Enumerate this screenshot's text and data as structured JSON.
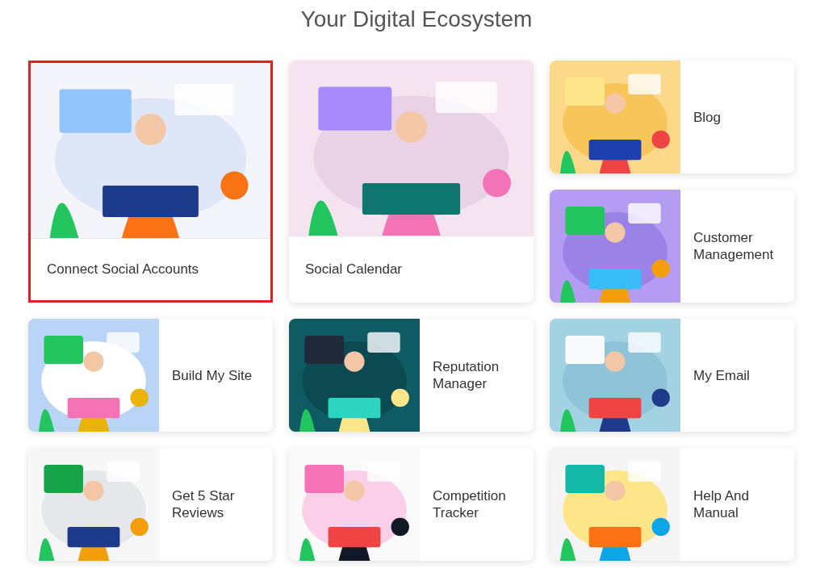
{
  "title": "Your Digital Ecosystem",
  "cards": [
    {
      "kind": "large",
      "label": "Connect Social Accounts",
      "selected": true
    },
    {
      "kind": "large",
      "label": "Social Calendar",
      "selected": false
    },
    {
      "kind": "small",
      "label": "Blog",
      "selected": false
    },
    {
      "kind": "small",
      "label": "Customer Management",
      "selected": false
    },
    {
      "kind": "small",
      "label": "Build My Site",
      "selected": false
    },
    {
      "kind": "small",
      "label": "Reputation Manager",
      "selected": false
    },
    {
      "kind": "small",
      "label": "My Email",
      "selected": false
    },
    {
      "kind": "small",
      "label": "Get 5 Star Reviews",
      "selected": false
    },
    {
      "kind": "small",
      "label": "Competition Tracker",
      "selected": false
    },
    {
      "kind": "small",
      "label": "Help And Manual",
      "selected": false
    }
  ]
}
